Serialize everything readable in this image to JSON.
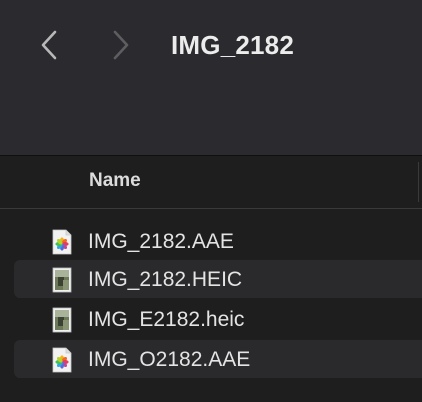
{
  "window": {
    "title": "IMG_2182"
  },
  "toolbar": {
    "back_icon": "chevron-left-icon",
    "forward_icon": "chevron-right-icon"
  },
  "list": {
    "column_header": "Name",
    "files": [
      {
        "name": "IMG_2182.AAE",
        "icon": "photos-document-icon"
      },
      {
        "name": "IMG_2182.HEIC",
        "icon": "image-thumbnail-icon"
      },
      {
        "name": "IMG_E2182.heic",
        "icon": "image-thumbnail-icon"
      },
      {
        "name": "IMG_O2182.AAE",
        "icon": "photos-document-icon"
      }
    ]
  },
  "colors": {
    "toolbar_bg": "#2b2a2e",
    "list_bg": "#1e1e1e",
    "alt_row_bg": "#2a2a2c",
    "text": "#e4e4e4"
  }
}
